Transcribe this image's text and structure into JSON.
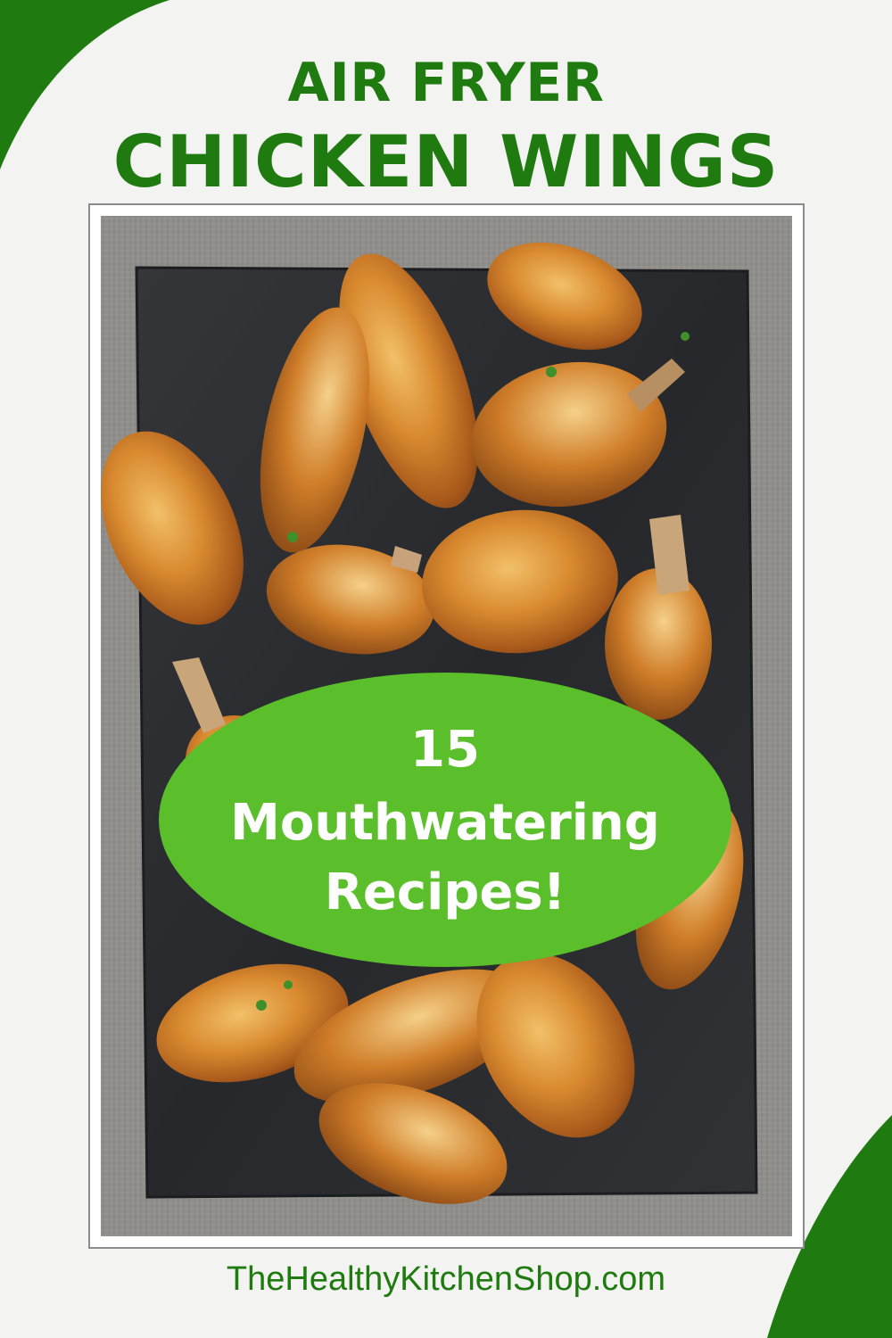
{
  "pin": {
    "title_line1": "AIR FRYER",
    "title_line2": "CHICKEN WINGS",
    "badge_count": "15",
    "badge_line2": "Mouthwatering",
    "badge_line3": "Recipes!",
    "website": "TheHealthyKitchenShop.com"
  },
  "colors": {
    "brand_green": "#1f7a0f",
    "badge_green": "#5bbf2b",
    "background": "#f3f3f1",
    "slate": "#2a2c30",
    "linen": "#8f8e8a"
  },
  "photo": {
    "subject": "air-fried chicken wings on a black slate board over grey linen"
  }
}
